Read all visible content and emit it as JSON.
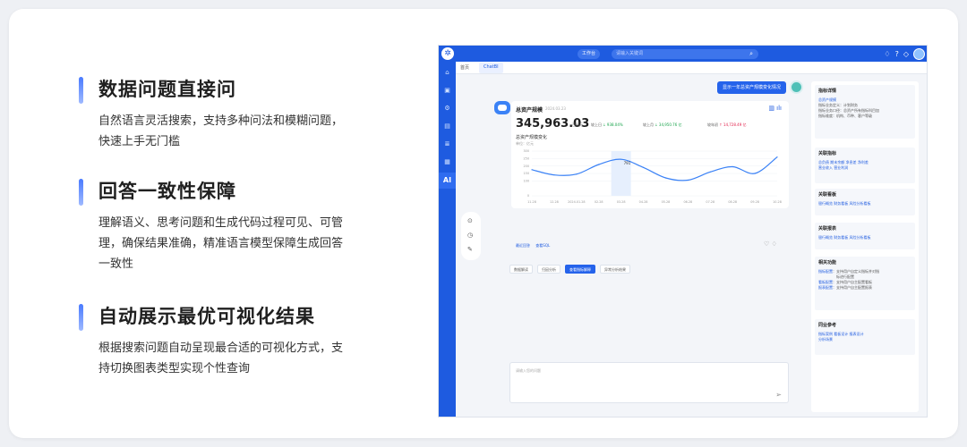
{
  "features": [
    {
      "title": "数据问题直接问",
      "desc": "自然语言灵活搜索，支持多种问法和模糊问题，快速上手无门槛"
    },
    {
      "title": "回答一致性保障",
      "desc": "理解语义、思考问题和生成代码过程可见、可管理，确保结果准确，精准语言模型保障生成回答一致性"
    },
    {
      "title": "自动展示最优可视化结果",
      "desc": "根据搜索问题自动呈现最合适的可视化方式，支持切换图表类型实现个性查询"
    }
  ],
  "app": {
    "workspace_btn": "工作台",
    "search_placeholder": "请输入关键词",
    "tabs": [
      "首页",
      "ChatBI"
    ],
    "question": "显示一年总资产规模变化情况",
    "answer": {
      "title": "总资产规模",
      "date": "2024.03.23",
      "kpi": "345,963.03",
      "kpi_unit": "百万元",
      "cmp1_label": "较上日",
      "cmp1_val": "↓ 938.04%",
      "cmp2_label": "较上月",
      "cmp2_val": "↓ 34,950.76 亿",
      "cmp3_label": "较年初",
      "cmp3_val": "↑ 14,728.49 亿",
      "chart_title": "总资产规模变化",
      "chart_unit": "单位：亿元",
      "links": [
        "最近回答",
        "查看SQL"
      ]
    },
    "chips": [
      "数据解读",
      "归因分析",
      "查看指标解释",
      "异常分析结果"
    ],
    "input_placeholder": "请输入您的问题",
    "right_panel": {
      "indicator": {
        "title": "指标详情",
        "name": "总资产规模",
        "lines": [
          "指标业务定义：计划财务",
          "指标业务口径：总资产所有指标科目加",
          "指标维度：机构、币种、客户等级"
        ]
      },
      "related_metrics": {
        "title": "关联指标",
        "row1": "总负债  期末余额  净息差  净利差",
        "row2": "营业收入  营业利润"
      },
      "related_boards": {
        "title": "关联看板",
        "row1": "银行概览  财务看板  风险分析看板"
      },
      "related_reports": {
        "title": "关联报表",
        "row1": "银行概览  财务看板  风险分析看板"
      },
      "functions": {
        "title": "相关功能",
        "items": [
          {
            "link": "指标配置",
            "text": "：支持用户自定义指标并对指"
          },
          {
            "link": "",
            "text": "标进行配置"
          },
          {
            "link": "看板配置",
            "text": "：支持用户自主配置看板"
          },
          {
            "link": "报表配置",
            "text": "：支持用户自主配置报表"
          }
        ]
      },
      "peers": {
        "title": "同业参考",
        "row1": "指标案例  看板设计  报表设计",
        "row2": "分析场景"
      }
    }
  },
  "chart_data": {
    "type": "line",
    "x": [
      "11.28",
      "12.28",
      "2024.01.28",
      "02.28",
      "03.28",
      "04.28",
      "05.28",
      "06.28",
      "07.28",
      "08.28",
      "09.28",
      "10.28"
    ],
    "values": [
      175,
      140,
      145,
      210,
      245,
      190,
      120,
      105,
      160,
      195,
      150,
      260
    ],
    "yticks": [
      0,
      100,
      150,
      200,
      250,
      300
    ],
    "ylim": [
      0,
      300
    ],
    "highlight_label": "791",
    "highlight_x": "03.28"
  }
}
